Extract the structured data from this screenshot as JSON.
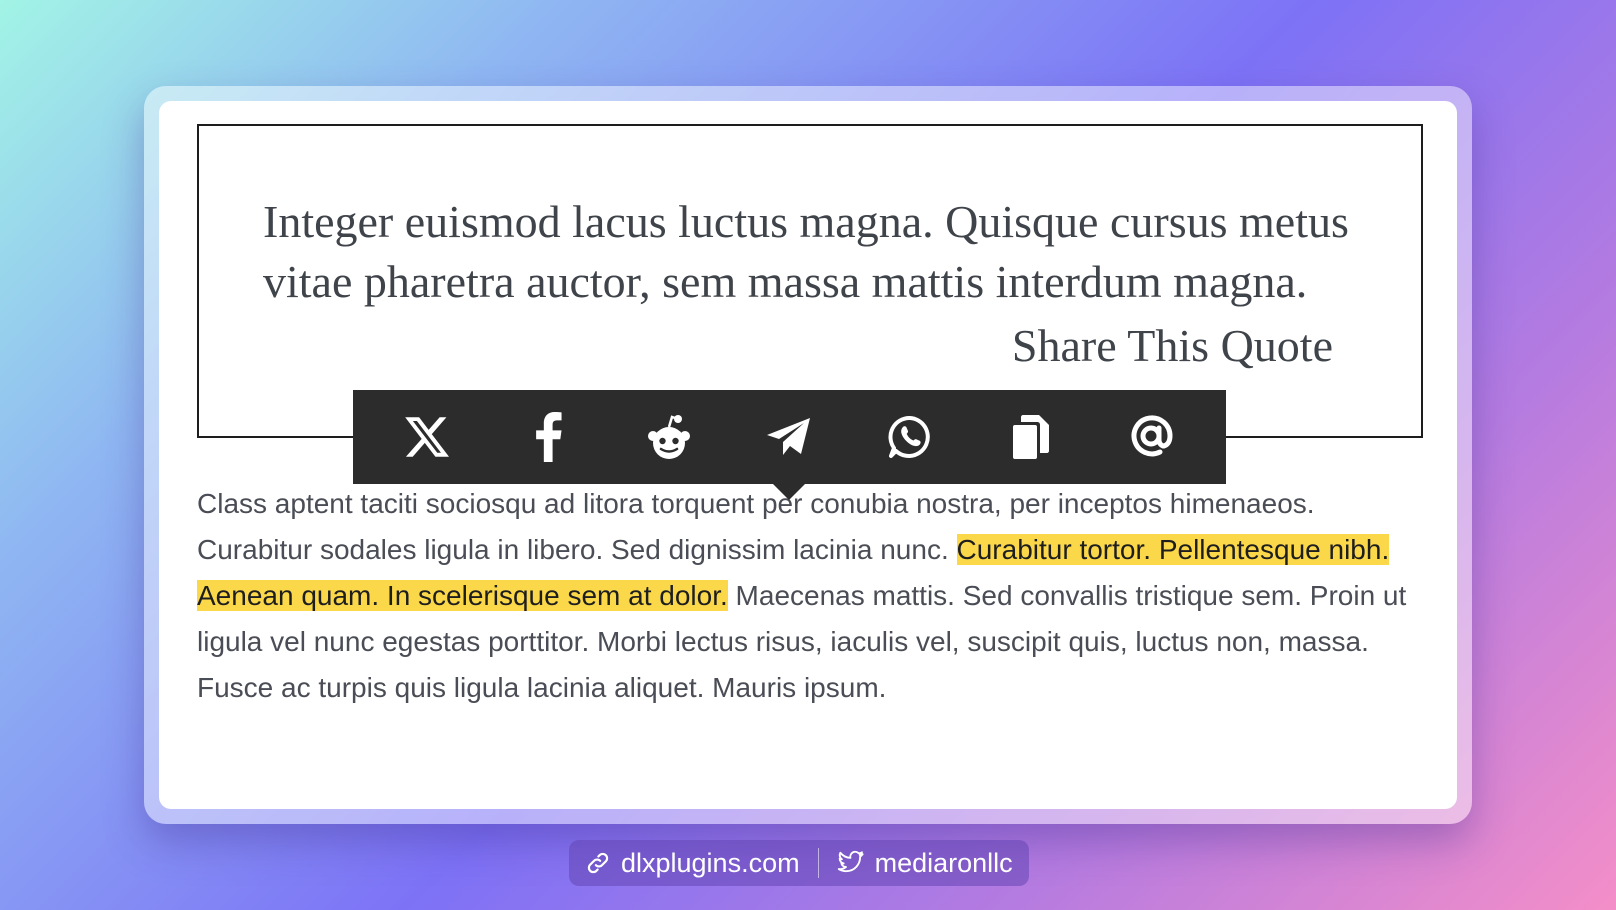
{
  "quote": {
    "text": "Integer euismod lacus luctus magna. Quisque cursus metus vitae pharetra auctor, sem massa mattis interdum magna.",
    "share_label": "Share This Quote"
  },
  "share_bar": {
    "buttons": [
      {
        "icon": "x-icon",
        "label": "X"
      },
      {
        "icon": "facebook-icon",
        "label": "Facebook"
      },
      {
        "icon": "reddit-icon",
        "label": "Reddit"
      },
      {
        "icon": "telegram-icon",
        "label": "Telegram"
      },
      {
        "icon": "whatsapp-icon",
        "label": "WhatsApp"
      },
      {
        "icon": "copy-icon",
        "label": "Copy"
      },
      {
        "icon": "email-icon",
        "label": "Email"
      }
    ]
  },
  "body": {
    "before_highlight": "Class aptent taciti sociosqu ad litora torquent per conubia nostra, per inceptos himenaeos. Curabitur sodales ligula in libero. Sed dignissim lacinia nunc. ",
    "highlight": "Curabitur tortor. Pellentesque nibh. Aenean quam. In scelerisque sem at dolor.",
    "after_highlight": " Maecenas mattis. Sed convallis tristique sem. Proin ut ligula vel nunc egestas porttitor. Morbi lectus risus, iaculis vel, suscipit quis, luctus non, massa. Fusce ac turpis quis ligula lacinia aliquet. Mauris ipsum."
  },
  "footer": {
    "site": "dlxplugins.com",
    "twitter": "mediaronllc"
  },
  "colors": {
    "highlight": "#fbd84a",
    "share_bar_bg": "#2c2c2c",
    "text": "#4a4d55"
  }
}
